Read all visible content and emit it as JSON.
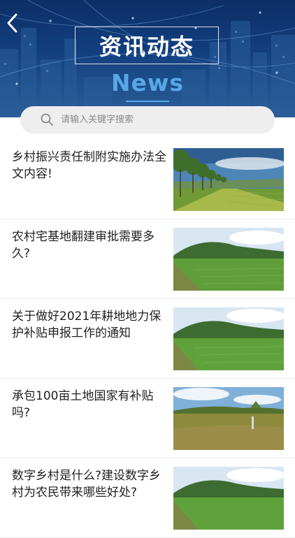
{
  "header": {
    "title": "资讯动态",
    "subtitle": "News"
  },
  "search": {
    "placeholder": "请输入关键字搜索"
  },
  "icons": {
    "back": "back-arrow-icon",
    "search": "search-icon"
  },
  "colors": {
    "header_dark": "#0c2f66",
    "accent": "#58a7e6",
    "text": "#222222"
  },
  "news": [
    {
      "title": "乡村振兴责任制附实施办法全文内容!",
      "image": "tree-lined-road-field-photo"
    },
    {
      "title": "农村宅基地翻建审批需要多久?",
      "image": "green-rice-field-photo"
    },
    {
      "title": "关于做好2021年耕地地力保护补贴申报工作的通知",
      "image": "green-rice-field-photo"
    },
    {
      "title": "承包100亩土地国家有补贴吗?",
      "image": "open-farmland-photo"
    },
    {
      "title": "数字乡村是什么?建设数字乡村为农民带来哪些好处?",
      "image": "green-rice-field-photo"
    }
  ]
}
